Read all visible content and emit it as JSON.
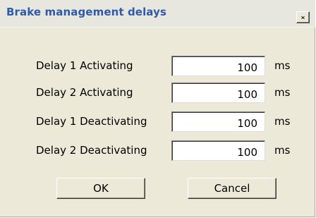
{
  "window": {
    "title": "Brake management delays",
    "close_icon": "close-icon"
  },
  "delays": [
    {
      "label": "Delay 1 Activating",
      "value": "100",
      "unit": "ms"
    },
    {
      "label": "Delay 2 Activating",
      "value": "100",
      "unit": "ms"
    },
    {
      "label": "Delay 1 Deactivating",
      "value": "100",
      "unit": "ms"
    },
    {
      "label": "Delay 2 Deactivating",
      "value": "100",
      "unit": "ms"
    }
  ],
  "buttons": {
    "ok_label": "OK",
    "cancel_label": "Cancel"
  },
  "colors": {
    "title_text": "#2f5ba8",
    "dialog_background": "#ece9d8"
  }
}
